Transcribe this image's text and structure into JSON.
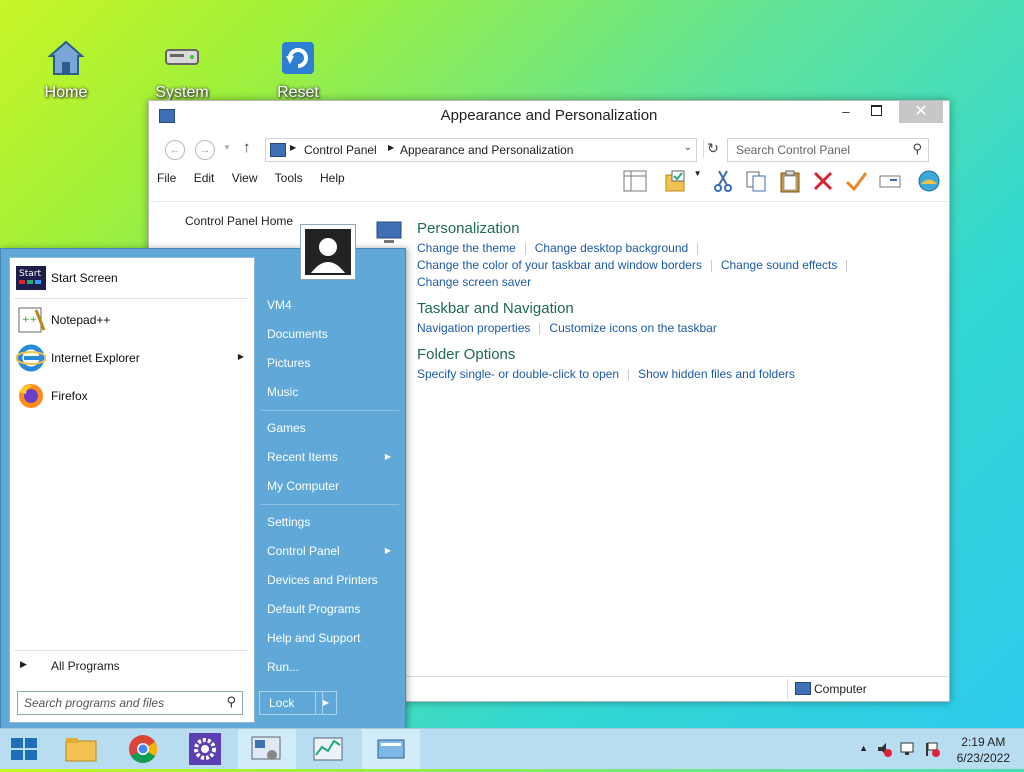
{
  "desktop": {
    "icons": [
      {
        "label": "Home"
      },
      {
        "label": "System"
      },
      {
        "label": "Reset"
      }
    ]
  },
  "window": {
    "title": "Appearance and Personalization",
    "breadcrumb": [
      "Control Panel",
      "Appearance and Personalization"
    ],
    "search_placeholder": "Search Control Panel",
    "menu": [
      "File",
      "Edit",
      "View",
      "Tools",
      "Help"
    ],
    "sidebar": {
      "home": "Control Panel Home"
    },
    "categories": [
      {
        "title": "Personalization",
        "links": [
          [
            "Change the theme",
            "Change desktop background"
          ],
          [
            "Change the color of your taskbar and window borders",
            "Change sound effects"
          ],
          [
            "Change screen saver"
          ]
        ]
      },
      {
        "title": "Taskbar and Navigation",
        "links": [
          [
            "Navigation properties",
            "Customize icons on the taskbar"
          ]
        ]
      },
      {
        "title": "Folder Options",
        "links": [
          [
            "Specify single- or double-click to open",
            "Show hidden files and folders"
          ]
        ]
      }
    ],
    "status": "Computer"
  },
  "start_menu": {
    "left": [
      {
        "label": "Start Screen",
        "icon": "start-screen-icon"
      },
      {
        "label": "Notepad++",
        "icon": "notepadpp-icon"
      },
      {
        "label": "Internet Explorer",
        "icon": "ie-icon"
      },
      {
        "label": "Firefox",
        "icon": "firefox-icon"
      }
    ],
    "all_programs": "All Programs",
    "search_placeholder": "Search programs and files",
    "right": [
      "VM4",
      "Documents",
      "Pictures",
      "Music",
      "Games",
      "Recent Items",
      "My Computer",
      "Settings",
      "Control Panel",
      "Devices and Printers",
      "Default Programs",
      "Help and Support",
      "Run..."
    ],
    "lock": "Lock"
  },
  "taskbar": {
    "time": "2:19 AM",
    "date": "6/23/2022"
  },
  "colors": {
    "link": "#1e5aa8",
    "heading": "#1e6b4e",
    "start_menu": "#5fa8d8",
    "taskbar": "#b8dcf0"
  }
}
